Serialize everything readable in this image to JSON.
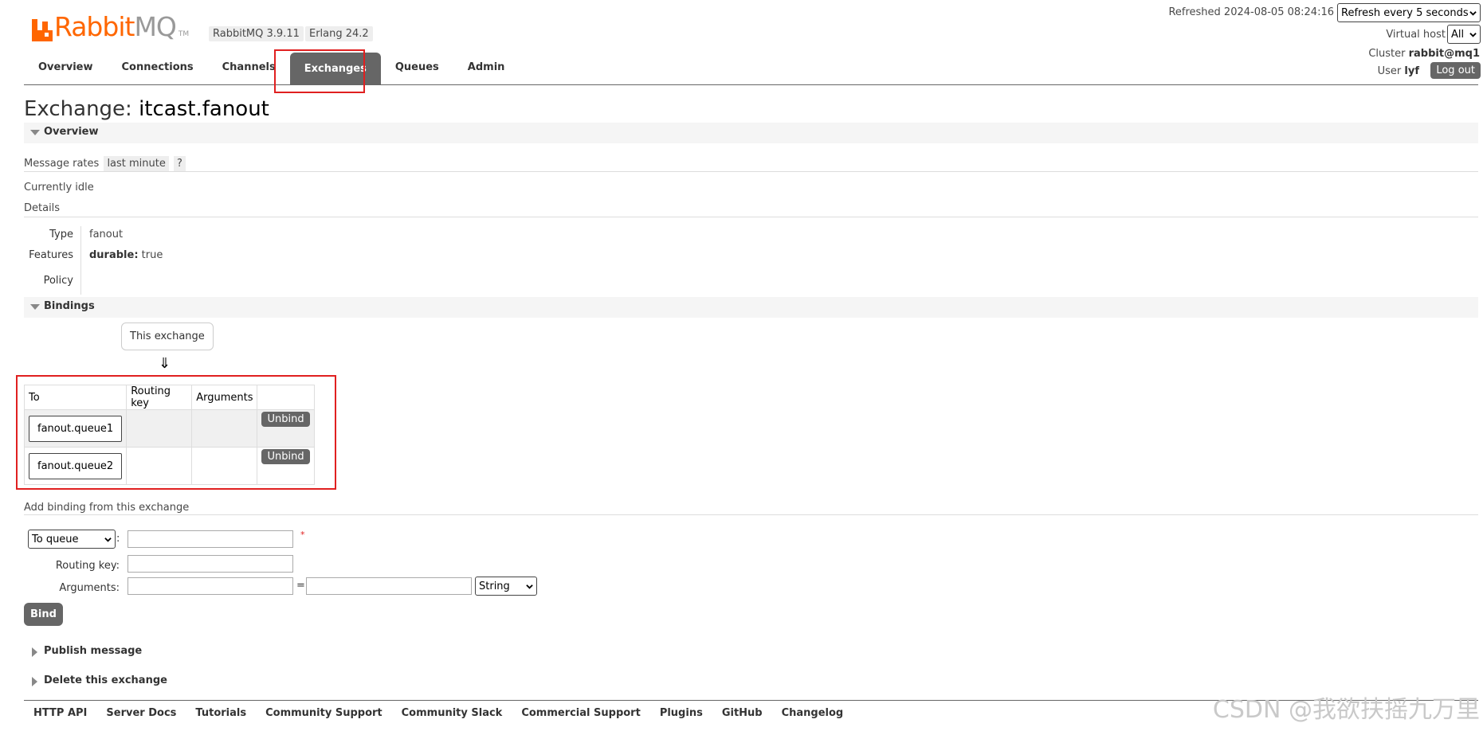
{
  "header": {
    "logo_text_primary": "Rabbit",
    "logo_text_secondary": "MQ",
    "logo_tm": "TM",
    "rabbitmq_version": "RabbitMQ 3.9.11",
    "erlang_version": "Erlang 24.2",
    "refreshed_label": "Refreshed 2024-08-05 08:24:16",
    "refresh_interval": "Refresh every 5 seconds",
    "virtual_host_label": "Virtual host",
    "virtual_host_value": "All",
    "cluster_label": "Cluster",
    "cluster_value": "rabbit@mq1",
    "user_label": "User",
    "user_value": "lyf",
    "logout_label": "Log out"
  },
  "tabs": [
    {
      "label": "Overview"
    },
    {
      "label": "Connections"
    },
    {
      "label": "Channels"
    },
    {
      "label": "Exchanges",
      "active": true
    },
    {
      "label": "Queues"
    },
    {
      "label": "Admin"
    }
  ],
  "page": {
    "title_prefix": "Exchange:",
    "exchange_name": "itcast.fanout"
  },
  "overview": {
    "section_label": "Overview",
    "message_rates_label": "Message rates",
    "message_rates_range": "last minute",
    "help": "?",
    "status": "Currently idle",
    "details_label": "Details",
    "type_key": "Type",
    "type_value": "fanout",
    "features_key": "Features",
    "features_durable_key": "durable:",
    "features_durable_value": "true",
    "policy_key": "Policy",
    "policy_value": ""
  },
  "bindings": {
    "section_label": "Bindings",
    "this_exchange": "This exchange",
    "arrow": "⇓",
    "columns": [
      "To",
      "Routing key",
      "Arguments",
      ""
    ],
    "rows": [
      {
        "to": "fanout.queue1",
        "routing_key": "",
        "arguments": "",
        "action": "Unbind"
      },
      {
        "to": "fanout.queue2",
        "routing_key": "",
        "arguments": "",
        "action": "Unbind"
      }
    ]
  },
  "add_binding": {
    "label": "Add binding from this exchange",
    "destination_type": "To queue",
    "destination_value": "",
    "required_mark": "*",
    "routing_key_label": "Routing key:",
    "routing_key_value": "",
    "arguments_label": "Arguments:",
    "arguments_key": "",
    "arguments_eq": "=",
    "arguments_value": "",
    "arguments_type": "String",
    "bind_label": "Bind",
    "colon": ":"
  },
  "collapsed_sections": {
    "publish": "Publish message",
    "delete": "Delete this exchange"
  },
  "footer": {
    "links": [
      "HTTP API",
      "Server Docs",
      "Tutorials",
      "Community Support",
      "Community Slack",
      "Commercial Support",
      "Plugins",
      "GitHub",
      "Changelog"
    ]
  },
  "watermark": "CSDN @我欲扶摇九万里",
  "colors": {
    "brand_orange": "#ff6600",
    "active_tab": "#666666",
    "highlight_red": "#e02020"
  }
}
